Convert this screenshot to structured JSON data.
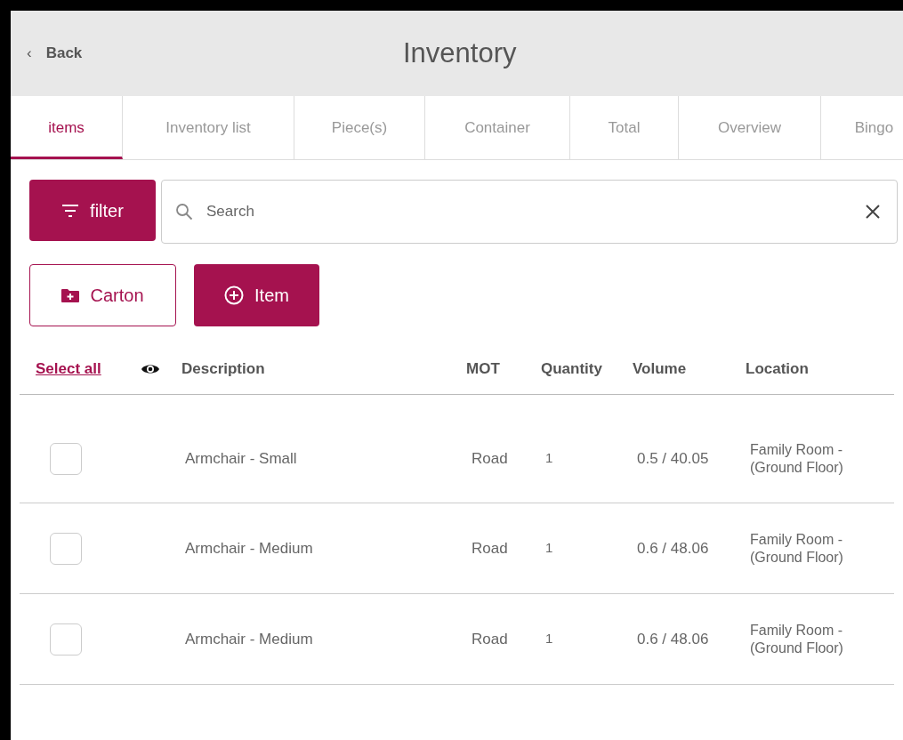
{
  "header": {
    "back": "Back",
    "back_icon": "‹",
    "title": "Inventory"
  },
  "tabs": [
    {
      "label": "items",
      "selected": true
    },
    {
      "label": "Inventory list",
      "selected": false
    },
    {
      "label": "Piece(s)",
      "selected": false
    },
    {
      "label": "Container",
      "selected": false
    },
    {
      "label": "Total",
      "selected": false
    },
    {
      "label": "Overview",
      "selected": false
    },
    {
      "label": "Bingo",
      "selected": false
    }
  ],
  "filter_button": "filter",
  "search": {
    "placeholder": "Search"
  },
  "actions": [
    {
      "kind": "carton",
      "label": "Carton"
    },
    {
      "kind": "item",
      "label": "Item"
    }
  ],
  "table": {
    "select_all": "Select all",
    "columns": [
      "Description",
      "MOT",
      "Quantity",
      "Volume",
      "Location"
    ],
    "rows": [
      {
        "checked": false,
        "cells": [
          "Armchair - Small",
          "Road",
          "1",
          "0.5 / 40.05",
          "Family Room - (Ground Floor)"
        ]
      },
      {
        "checked": false,
        "cells": [
          "Armchair - Medium",
          "Road",
          "1",
          "0.6 / 48.06",
          "Family Room - (Ground Floor)"
        ]
      },
      {
        "checked": false,
        "cells": [
          "Armchair - Medium",
          "Road",
          "1",
          "0.6 / 48.06",
          "Family Room - (Ground Floor)"
        ]
      }
    ]
  }
}
